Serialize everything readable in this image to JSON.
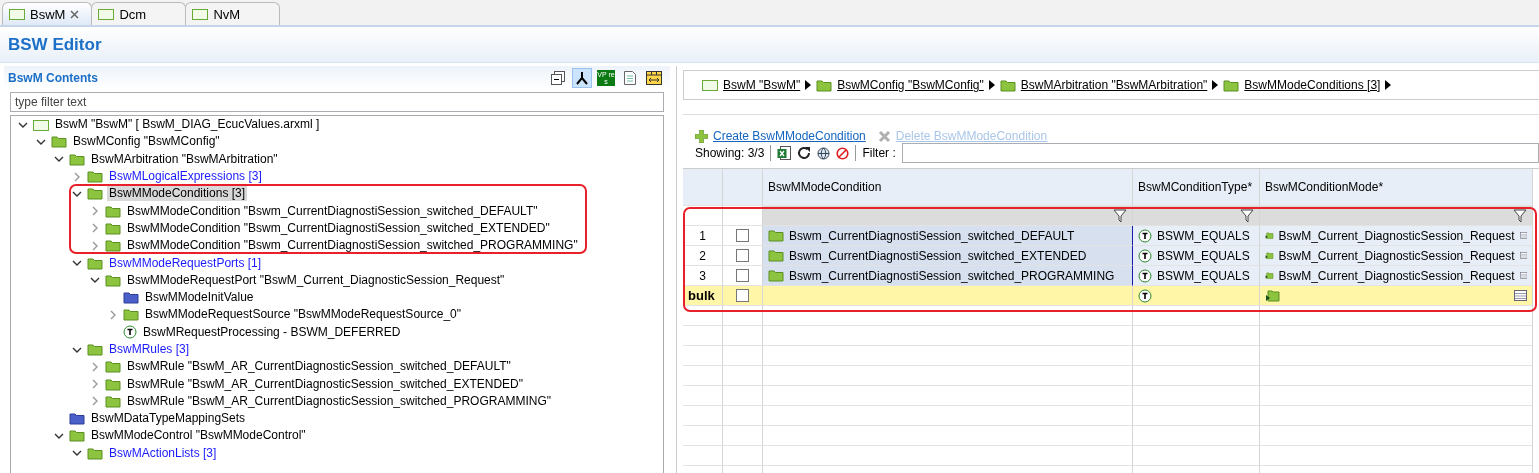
{
  "tabs": [
    {
      "label": "BswM",
      "selected": true,
      "closable": true
    },
    {
      "label": "Dcm",
      "selected": false,
      "closable": false
    },
    {
      "label": "NvM",
      "selected": false,
      "closable": false
    }
  ],
  "editor_title": "BSW Editor",
  "contents": {
    "title": "BswM Contents",
    "toolbar": [
      {
        "kind": "collapse",
        "on": false
      },
      {
        "kind": "tree",
        "on": true
      },
      {
        "kind": "vp",
        "label": "VP res",
        "on": false
      },
      {
        "kind": "document",
        "on": false
      },
      {
        "kind": "columns",
        "on": false
      }
    ],
    "filter": {
      "placeholder": "type filter text"
    },
    "tree": [
      {
        "label": "BswM \"BswM\" [ BswM_DIAG_EcucValues.arxml ]",
        "kind": "module",
        "expanded": true,
        "selected": false,
        "link": false,
        "children": [
          {
            "label": "BswMConfig \"BswMConfig\"",
            "kind": "folder",
            "expanded": true,
            "selected": false,
            "link": false,
            "children": [
              {
                "label": "BswMArbitration \"BswMArbitration\"",
                "kind": "folder",
                "expanded": true,
                "selected": false,
                "link": false,
                "children": [
                  {
                    "label": "BswMLogicalExpressions [3]",
                    "kind": "folder",
                    "link": true,
                    "expanded": false,
                    "selected": false
                  },
                  {
                    "label": "BswMModeConditions [3]",
                    "kind": "folder",
                    "expanded": true,
                    "selected": true,
                    "link": false,
                    "highlighted": true,
                    "children": [
                      {
                        "label": "BswMModeCondition \"Bswm_CurrentDiagnostiSession_switched_DEFAULT\"",
                        "kind": "folder",
                        "expanded": false,
                        "selected": false,
                        "link": false
                      },
                      {
                        "label": "BswMModeCondition \"Bswm_CurrentDiagnostiSession_switched_EXTENDED\"",
                        "kind": "folder",
                        "expanded": false,
                        "selected": false,
                        "link": false
                      },
                      {
                        "label": "BswMModeCondition \"Bswm_CurrentDiagnostiSession_switched_PROGRAMMING\"",
                        "kind": "folder",
                        "expanded": false,
                        "selected": false,
                        "link": false
                      }
                    ]
                  },
                  {
                    "label": "BswMModeRequestPorts [1]",
                    "kind": "folder",
                    "link": true,
                    "expanded": true,
                    "selected": false,
                    "children": [
                      {
                        "label": "BswMModeRequestPort \"BswM_Current_DiagnosticSession_Request\"",
                        "kind": "folder",
                        "expanded": true,
                        "selected": false,
                        "link": false,
                        "children": [
                          {
                            "label": "BswMModeInitValue",
                            "kind": "folder-blue",
                            "selected": false,
                            "link": false
                          },
                          {
                            "label": "BswMModeRequestSource \"BswMModeRequestSource_0\"",
                            "kind": "folder",
                            "expanded": false,
                            "selected": false,
                            "link": false
                          },
                          {
                            "label": "BswMRequestProcessing - BSWM_DEFERRED",
                            "kind": "text",
                            "selected": false,
                            "link": false
                          }
                        ]
                      }
                    ]
                  },
                  {
                    "label": "BswMRules [3]",
                    "kind": "folder",
                    "link": true,
                    "expanded": true,
                    "selected": false,
                    "children": [
                      {
                        "label": "BswMRule \"BswM_AR_CurrentDiagnosticSession_switched_DEFAULT\"",
                        "kind": "folder",
                        "expanded": false,
                        "selected": false,
                        "link": false
                      },
                      {
                        "label": "BswMRule \"BswM_AR_CurrentDiagnosticSession_switched_EXTENDED\"",
                        "kind": "folder",
                        "expanded": false,
                        "selected": false,
                        "link": false
                      },
                      {
                        "label": "BswMRule \"BswM_AR_CurrentDiagnosticSession_switched_PROGRAMMING\"",
                        "kind": "folder",
                        "expanded": false,
                        "selected": false,
                        "link": false
                      }
                    ]
                  }
                ]
              },
              {
                "label": "BswMDataTypeMappingSets",
                "kind": "folder-blue",
                "selected": false,
                "link": false
              },
              {
                "label": "BswMModeControl \"BswMModeControl\"",
                "kind": "folder",
                "expanded": true,
                "selected": false,
                "link": false,
                "children": [
                  {
                    "label": "BswMActionLists [3]",
                    "kind": "folder",
                    "link": true,
                    "expanded": true,
                    "selected": false
                  }
                ]
              }
            ]
          }
        ]
      }
    ]
  },
  "breadcrumb": [
    {
      "label": "BswM \"BswM\"",
      "kind": "module"
    },
    {
      "label": "BswMConfig \"BswMConfig\"",
      "kind": "folder"
    },
    {
      "label": "BswMArbitration \"BswMArbitration\"",
      "kind": "folder"
    },
    {
      "label": "BswMModeConditions [3]",
      "kind": "folder"
    }
  ],
  "actions": [
    {
      "label": "Create BswMModeCondition",
      "kind": "create",
      "disabled": false
    },
    {
      "label": "Delete BswMModeCondition",
      "kind": "delete",
      "disabled": true
    }
  ],
  "showing": "Showing: 3/3",
  "filter_label": "Filter :",
  "table": {
    "highlighted": true,
    "columns": [
      "BswMModeCondition",
      "BswMConditionType*",
      "BswMConditionMode*"
    ],
    "rows": [
      {
        "number": "1",
        "checked": false,
        "condition": "Bswm_CurrentDiagnostiSession_switched_DEFAULT",
        "type": "BSWM_EQUALS",
        "mode": "BswM_Current_DiagnosticSession_Request"
      },
      {
        "number": "2",
        "checked": false,
        "condition": "Bswm_CurrentDiagnostiSession_switched_EXTENDED",
        "type": "BSWM_EQUALS",
        "mode": "BswM_Current_DiagnosticSession_Request"
      },
      {
        "number": "3",
        "checked": false,
        "condition": "Bswm_CurrentDiagnostiSession_switched_PROGRAMMING",
        "type": "BSWM_EQUALS",
        "mode": "BswM_Current_DiagnosticSession_Request"
      }
    ],
    "bulk": {
      "label": "bulk",
      "checked": false
    }
  }
}
